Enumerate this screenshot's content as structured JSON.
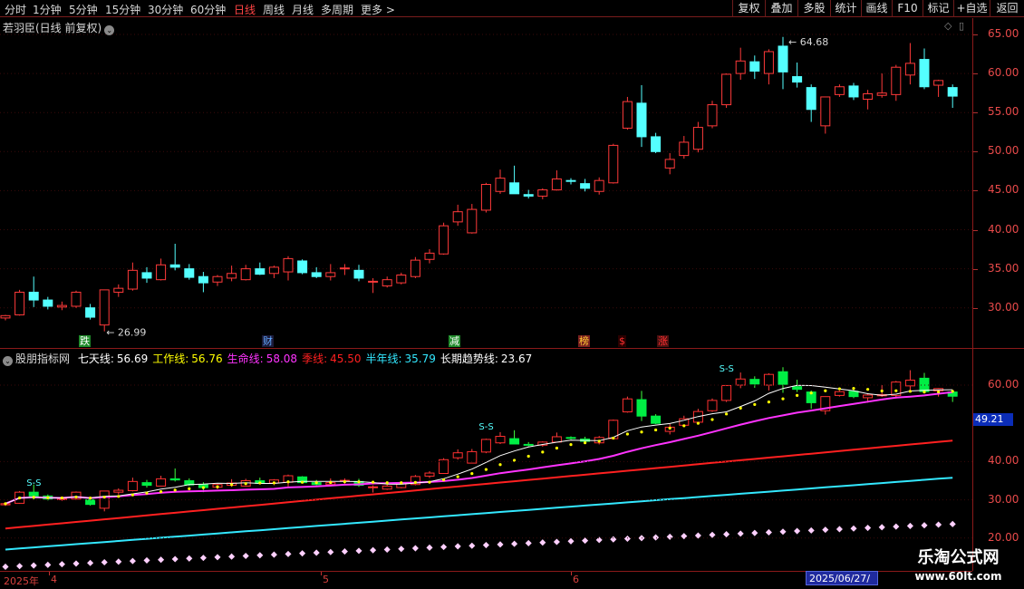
{
  "toolbar": {
    "periods": [
      "分时",
      "1分钟",
      "5分钟",
      "15分钟",
      "30分钟",
      "60分钟",
      "日线",
      "周线",
      "月线",
      "多周期",
      "更多 >"
    ],
    "active_period": "日线",
    "tools": [
      "复权",
      "叠加",
      "多股",
      "统计",
      "画线",
      "F10",
      "标记",
      "+自选",
      "返回"
    ]
  },
  "main_chart": {
    "title": "若羽臣(日线 前复权)",
    "y_ticks": [
      "65.00",
      "60.00",
      "55.00",
      "50.00",
      "45.00",
      "40.00",
      "35.00",
      "30.00"
    ],
    "max_label": "64.68",
    "min_label": "26.99",
    "events": [
      {
        "text": "跌",
        "color": "#ffffff",
        "bg": "#1f8a2a"
      },
      {
        "text": "财",
        "color": "#62a8ff",
        "bg": "#1b1b3a"
      },
      {
        "text": "减",
        "color": "#ffffff",
        "bg": "#1f8a2a"
      },
      {
        "text": "榜",
        "color": "#ffcc33",
        "bg": "#7a2020"
      },
      {
        "text": "$",
        "color": "#ff3030",
        "bg": "#2a0000"
      },
      {
        "text": "涨",
        "color": "#ff3030",
        "bg": "#4a1010"
      }
    ]
  },
  "indicator": {
    "name": "股朋指标网",
    "items": [
      {
        "label": "七天线:",
        "value": "56.69",
        "color": "#ffffff"
      },
      {
        "label": "工作线:",
        "value": "56.76",
        "color": "#ffff00"
      },
      {
        "label": "生命线:",
        "value": "58.08",
        "color": "#ff33ff"
      },
      {
        "label": "季线:",
        "value": "45.50",
        "color": "#ff2020"
      },
      {
        "label": "半年线:",
        "value": "35.79",
        "color": "#33e8ff"
      },
      {
        "label": "长期趋势线:",
        "value": "23.67",
        "color": "#ffffff"
      }
    ],
    "y_ticks": [
      "60.00",
      "40.00",
      "30.00",
      "20.00"
    ],
    "cursor_value": "49.21",
    "badges": [
      "S-S",
      "S-S",
      "S-S"
    ]
  },
  "date_axis": {
    "labels": [
      "2025年",
      "4",
      "5",
      "6"
    ],
    "cursor_date": "2025/06/27/五"
  },
  "watermark": {
    "line1": "乐淘公式网",
    "line2": "www.60lt.com"
  },
  "colors": {
    "up": "#ff3a3a",
    "down": "#54ffff",
    "grid": "#8b1a1a",
    "axis_text": "#e84a4a"
  },
  "chart_data": {
    "type": "candlestick",
    "x": [
      "03-26",
      "03-27",
      "03-28",
      "03-31",
      "04-01",
      "04-02",
      "04-03",
      "04-07",
      "04-08",
      "04-09",
      "04-10",
      "04-11",
      "04-14",
      "04-15",
      "04-16",
      "04-17",
      "04-18",
      "04-21",
      "04-22",
      "04-23",
      "04-24",
      "04-25",
      "04-28",
      "04-29",
      "04-30",
      "05-06",
      "05-07",
      "05-08",
      "05-09",
      "05-12",
      "05-13",
      "05-14",
      "05-15",
      "05-16",
      "05-19",
      "05-20",
      "05-21",
      "05-22",
      "05-23",
      "05-26",
      "05-27",
      "05-28",
      "05-29",
      "05-30",
      "06-03",
      "06-04",
      "06-05",
      "06-06",
      "06-09",
      "06-10",
      "06-11",
      "06-12",
      "06-13",
      "06-16",
      "06-17",
      "06-18",
      "06-19",
      "06-20",
      "06-23",
      "06-24",
      "06-25",
      "06-26",
      "06-27",
      "06-30",
      "07-01",
      "07-02",
      "07-03",
      "07-04"
    ],
    "ohlc": [
      [
        28.7,
        29.1,
        28.4,
        29.0
      ],
      [
        29.1,
        32.3,
        29.0,
        32.0
      ],
      [
        32.0,
        34.0,
        30.1,
        31.0
      ],
      [
        31.0,
        31.4,
        29.8,
        30.2
      ],
      [
        30.1,
        30.8,
        29.7,
        30.3
      ],
      [
        30.2,
        32.2,
        30.0,
        32.0
      ],
      [
        30.0,
        30.5,
        28.5,
        28.8
      ],
      [
        27.8,
        32.3,
        26.99,
        32.3
      ],
      [
        32.0,
        33.0,
        31.4,
        32.5
      ],
      [
        32.4,
        35.8,
        32.2,
        34.8
      ],
      [
        34.5,
        35.2,
        33.2,
        33.8
      ],
      [
        33.6,
        36.3,
        33.5,
        35.5
      ],
      [
        35.5,
        38.2,
        34.8,
        35.2
      ],
      [
        35.0,
        35.6,
        33.6,
        33.9
      ],
      [
        34.0,
        34.6,
        32.0,
        33.2
      ],
      [
        33.3,
        34.2,
        32.8,
        34.0
      ],
      [
        33.8,
        35.4,
        33.4,
        34.4
      ],
      [
        33.6,
        35.5,
        33.5,
        35.0
      ],
      [
        35.0,
        35.8,
        34.2,
        34.3
      ],
      [
        34.4,
        35.4,
        33.8,
        35.2
      ],
      [
        34.6,
        36.6,
        33.5,
        36.3
      ],
      [
        36.0,
        36.2,
        34.3,
        34.5
      ],
      [
        34.5,
        35.2,
        33.8,
        34.0
      ],
      [
        34.0,
        35.6,
        33.5,
        34.5
      ],
      [
        35.0,
        35.6,
        34.2,
        35.1
      ],
      [
        34.8,
        35.5,
        33.4,
        33.8
      ],
      [
        33.3,
        33.8,
        31.9,
        33.4
      ],
      [
        32.8,
        34.0,
        32.6,
        33.6
      ],
      [
        33.2,
        34.5,
        33.0,
        34.2
      ],
      [
        34.0,
        36.5,
        33.8,
        36.1
      ],
      [
        36.2,
        37.5,
        35.7,
        37.0
      ],
      [
        36.9,
        40.9,
        36.8,
        40.5
      ],
      [
        41.0,
        43.2,
        40.5,
        42.3
      ],
      [
        39.6,
        43.3,
        39.5,
        42.6
      ],
      [
        42.5,
        46.0,
        42.2,
        45.8
      ],
      [
        44.9,
        47.7,
        44.6,
        46.6
      ],
      [
        46.0,
        48.2,
        45.0,
        44.6
      ],
      [
        44.5,
        45.1,
        44.0,
        44.3
      ],
      [
        44.3,
        45.3,
        43.9,
        45.1
      ],
      [
        45.1,
        47.6,
        45.0,
        46.5
      ],
      [
        46.3,
        46.6,
        45.8,
        46.2
      ],
      [
        45.9,
        46.5,
        44.9,
        45.3
      ],
      [
        44.9,
        46.7,
        44.5,
        46.3
      ],
      [
        46.0,
        51.0,
        45.9,
        50.8
      ],
      [
        53.0,
        57.0,
        52.8,
        56.4
      ],
      [
        56.2,
        58.5,
        50.6,
        51.9
      ],
      [
        51.9,
        52.4,
        49.8,
        50.0
      ],
      [
        47.9,
        49.8,
        47.1,
        49.0
      ],
      [
        49.5,
        52.0,
        49.1,
        51.2
      ],
      [
        50.3,
        53.8,
        49.9,
        53.1
      ],
      [
        53.3,
        56.5,
        53.0,
        56.0
      ],
      [
        56.0,
        60.0,
        55.6,
        59.9
      ],
      [
        60.0,
        63.3,
        59.2,
        61.6
      ],
      [
        61.5,
        62.3,
        59.3,
        60.3
      ],
      [
        60.0,
        63.1,
        58.6,
        62.8
      ],
      [
        63.5,
        64.68,
        58.0,
        60.2
      ],
      [
        59.6,
        61.4,
        58.2,
        58.9
      ],
      [
        58.2,
        58.6,
        53.8,
        55.4
      ],
      [
        53.3,
        57.0,
        52.3,
        57.0
      ],
      [
        57.3,
        58.6,
        57.0,
        58.3
      ],
      [
        58.4,
        58.8,
        56.6,
        57.0
      ],
      [
        56.7,
        57.9,
        55.4,
        57.4
      ],
      [
        57.2,
        60.0,
        56.9,
        57.5
      ],
      [
        57.3,
        61.1,
        56.5,
        60.8
      ],
      [
        59.8,
        63.9,
        58.6,
        61.3
      ],
      [
        61.8,
        63.2,
        58.0,
        58.3
      ],
      [
        58.5,
        59.2,
        57.0,
        59.1
      ],
      [
        58.2,
        58.6,
        55.6,
        57.1
      ]
    ]
  }
}
